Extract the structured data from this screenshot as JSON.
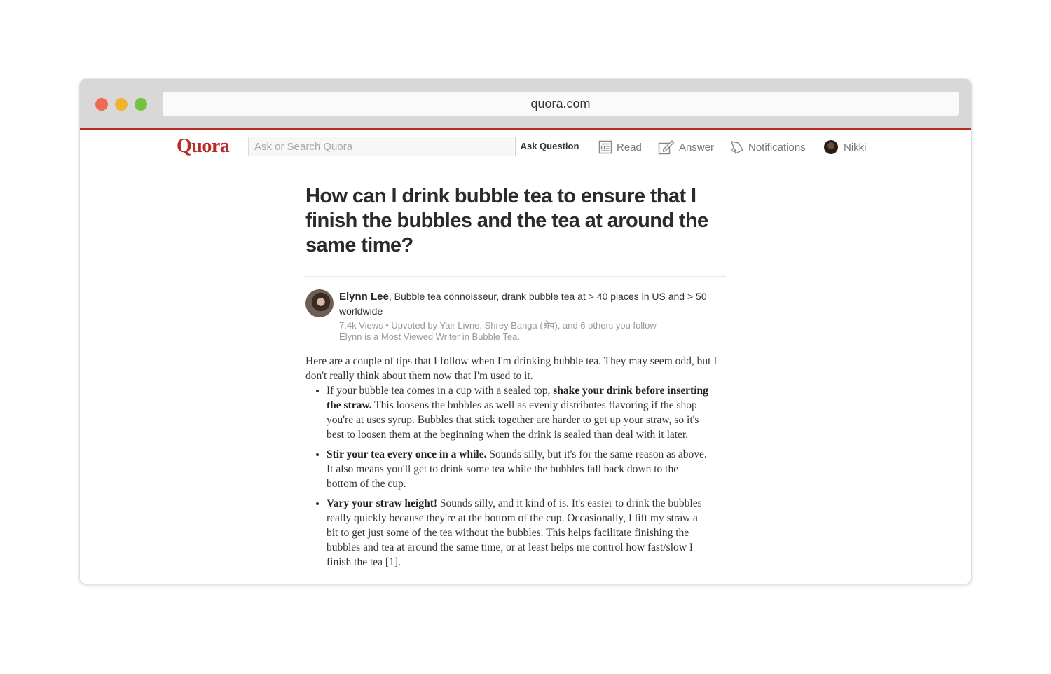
{
  "browser": {
    "url": "quora.com",
    "controls": [
      "close",
      "minimize",
      "zoom"
    ]
  },
  "nav": {
    "logo": "Quora",
    "search_placeholder": "Ask or Search Quora",
    "ask_button": "Ask Question",
    "links": {
      "read": "Read",
      "answer": "Answer",
      "notifications": "Notifications",
      "user": "Nikki"
    }
  },
  "question": {
    "title": "How can I drink bubble tea to ensure that I finish the bubbles and the tea at around the same time?"
  },
  "author": {
    "name": "Elynn Lee",
    "credential": ", Bubble tea connoisseur, drank bubble tea at > 40 places in US and > 50 worldwide",
    "stats": "7.4k Views • Upvoted by Yair Livne, Shrey Banga (श्रेय), and 6 others you follow",
    "badge": "Elynn is a Most Viewed Writer in Bubble Tea."
  },
  "answer": {
    "intro": "Here are a couple of tips that I follow when I'm drinking bubble tea. They may seem odd, but I don't really think about them now that I'm used to it.",
    "tips": [
      {
        "pre": "If your bubble tea comes in a cup with a sealed top, ",
        "bold": "shake your drink before inserting the straw.",
        "post": " This loosens the bubbles as well as evenly distributes flavoring if the shop you're at uses syrup. Bubbles that stick together are harder to get up your straw, so it's best to loosen them at the beginning when the drink is sealed than deal with it later."
      },
      {
        "pre": "",
        "bold": "Stir your tea every once in a while.",
        "post": " Sounds silly, but it's for the same reason as above. It also means you'll get to drink some tea while the bubbles fall back down to the bottom of the cup."
      },
      {
        "pre": "",
        "bold": "Vary your straw height!",
        "post": " Sounds silly, and it kind of is. It's easier to drink the bubbles really quickly because they're at the bottom of the cup. Occasionally, I lift my straw a bit to get just some of the tea without the bubbles. This helps facilitate finishing the bubbles and tea at around the same time, or at least helps me control how fast/slow I finish the tea [1]."
      }
    ]
  },
  "colors": {
    "brand": "#b92b27",
    "close": "#ee6a50",
    "minimize": "#f0b32f",
    "zoom": "#72c23e"
  }
}
